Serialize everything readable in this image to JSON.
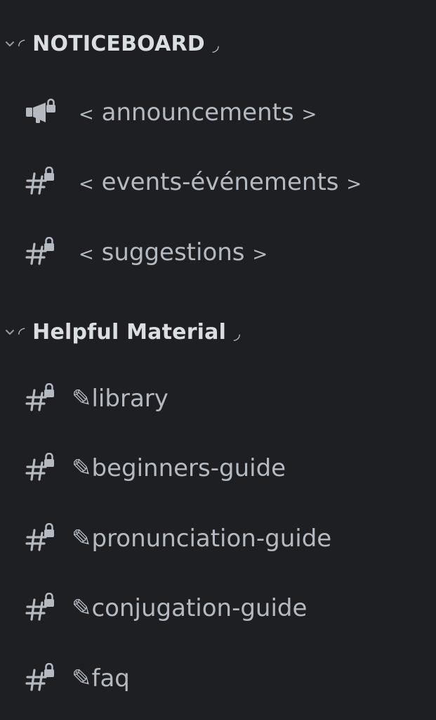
{
  "categories": [
    {
      "name": "NOTICEBOARD",
      "deco_left": "◜",
      "deco_right": "◞",
      "channels": [
        {
          "type": "announcement",
          "open": "<",
          "label": "announcements",
          "close": ">"
        },
        {
          "type": "text-locked",
          "open": "<",
          "label": "events-événements",
          "close": ">"
        },
        {
          "type": "text-locked",
          "open": "<",
          "label": "suggestions",
          "close": ">"
        }
      ]
    },
    {
      "name": "Helpful Material",
      "deco_left": "◜",
      "deco_right": "◞",
      "channels": [
        {
          "type": "text-locked",
          "label": "✎library"
        },
        {
          "type": "text-locked",
          "label": "✎beginners-guide"
        },
        {
          "type": "text-locked",
          "label": "✎pronunciation-guide"
        },
        {
          "type": "text-locked",
          "label": "✎conjugation-guide"
        },
        {
          "type": "text-locked",
          "label": "✎faq"
        }
      ]
    }
  ],
  "icons": {
    "chevron": "chevron-down-icon",
    "announcement": "megaphone-lock-icon",
    "text-locked": "hashtag-lock-icon"
  },
  "colors": {
    "background": "#1e1f22",
    "text": "#b5bac1",
    "category_text": "#dbdee1"
  }
}
